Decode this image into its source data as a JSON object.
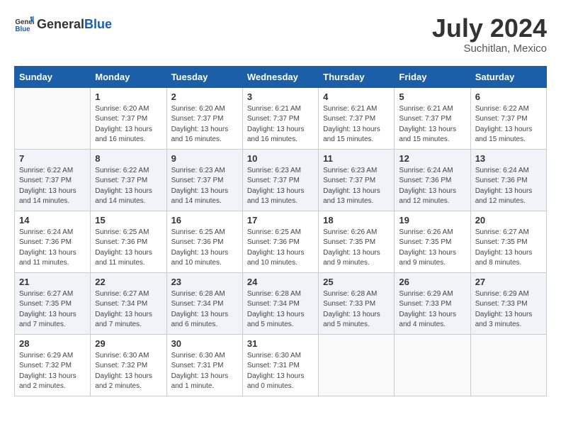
{
  "header": {
    "logo_general": "General",
    "logo_blue": "Blue",
    "month_year": "July 2024",
    "location": "Suchitlan, Mexico"
  },
  "days_of_week": [
    "Sunday",
    "Monday",
    "Tuesday",
    "Wednesday",
    "Thursday",
    "Friday",
    "Saturday"
  ],
  "weeks": [
    [
      {
        "num": "",
        "info": ""
      },
      {
        "num": "1",
        "info": "Sunrise: 6:20 AM\nSunset: 7:37 PM\nDaylight: 13 hours\nand 16 minutes."
      },
      {
        "num": "2",
        "info": "Sunrise: 6:20 AM\nSunset: 7:37 PM\nDaylight: 13 hours\nand 16 minutes."
      },
      {
        "num": "3",
        "info": "Sunrise: 6:21 AM\nSunset: 7:37 PM\nDaylight: 13 hours\nand 16 minutes."
      },
      {
        "num": "4",
        "info": "Sunrise: 6:21 AM\nSunset: 7:37 PM\nDaylight: 13 hours\nand 15 minutes."
      },
      {
        "num": "5",
        "info": "Sunrise: 6:21 AM\nSunset: 7:37 PM\nDaylight: 13 hours\nand 15 minutes."
      },
      {
        "num": "6",
        "info": "Sunrise: 6:22 AM\nSunset: 7:37 PM\nDaylight: 13 hours\nand 15 minutes."
      }
    ],
    [
      {
        "num": "7",
        "info": "Sunrise: 6:22 AM\nSunset: 7:37 PM\nDaylight: 13 hours\nand 14 minutes."
      },
      {
        "num": "8",
        "info": "Sunrise: 6:22 AM\nSunset: 7:37 PM\nDaylight: 13 hours\nand 14 minutes."
      },
      {
        "num": "9",
        "info": "Sunrise: 6:23 AM\nSunset: 7:37 PM\nDaylight: 13 hours\nand 14 minutes."
      },
      {
        "num": "10",
        "info": "Sunrise: 6:23 AM\nSunset: 7:37 PM\nDaylight: 13 hours\nand 13 minutes."
      },
      {
        "num": "11",
        "info": "Sunrise: 6:23 AM\nSunset: 7:37 PM\nDaylight: 13 hours\nand 13 minutes."
      },
      {
        "num": "12",
        "info": "Sunrise: 6:24 AM\nSunset: 7:36 PM\nDaylight: 13 hours\nand 12 minutes."
      },
      {
        "num": "13",
        "info": "Sunrise: 6:24 AM\nSunset: 7:36 PM\nDaylight: 13 hours\nand 12 minutes."
      }
    ],
    [
      {
        "num": "14",
        "info": "Sunrise: 6:24 AM\nSunset: 7:36 PM\nDaylight: 13 hours\nand 11 minutes."
      },
      {
        "num": "15",
        "info": "Sunrise: 6:25 AM\nSunset: 7:36 PM\nDaylight: 13 hours\nand 11 minutes."
      },
      {
        "num": "16",
        "info": "Sunrise: 6:25 AM\nSunset: 7:36 PM\nDaylight: 13 hours\nand 10 minutes."
      },
      {
        "num": "17",
        "info": "Sunrise: 6:25 AM\nSunset: 7:36 PM\nDaylight: 13 hours\nand 10 minutes."
      },
      {
        "num": "18",
        "info": "Sunrise: 6:26 AM\nSunset: 7:35 PM\nDaylight: 13 hours\nand 9 minutes."
      },
      {
        "num": "19",
        "info": "Sunrise: 6:26 AM\nSunset: 7:35 PM\nDaylight: 13 hours\nand 9 minutes."
      },
      {
        "num": "20",
        "info": "Sunrise: 6:27 AM\nSunset: 7:35 PM\nDaylight: 13 hours\nand 8 minutes."
      }
    ],
    [
      {
        "num": "21",
        "info": "Sunrise: 6:27 AM\nSunset: 7:35 PM\nDaylight: 13 hours\nand 7 minutes."
      },
      {
        "num": "22",
        "info": "Sunrise: 6:27 AM\nSunset: 7:34 PM\nDaylight: 13 hours\nand 7 minutes."
      },
      {
        "num": "23",
        "info": "Sunrise: 6:28 AM\nSunset: 7:34 PM\nDaylight: 13 hours\nand 6 minutes."
      },
      {
        "num": "24",
        "info": "Sunrise: 6:28 AM\nSunset: 7:34 PM\nDaylight: 13 hours\nand 5 minutes."
      },
      {
        "num": "25",
        "info": "Sunrise: 6:28 AM\nSunset: 7:33 PM\nDaylight: 13 hours\nand 5 minutes."
      },
      {
        "num": "26",
        "info": "Sunrise: 6:29 AM\nSunset: 7:33 PM\nDaylight: 13 hours\nand 4 minutes."
      },
      {
        "num": "27",
        "info": "Sunrise: 6:29 AM\nSunset: 7:33 PM\nDaylight: 13 hours\nand 3 minutes."
      }
    ],
    [
      {
        "num": "28",
        "info": "Sunrise: 6:29 AM\nSunset: 7:32 PM\nDaylight: 13 hours\nand 2 minutes."
      },
      {
        "num": "29",
        "info": "Sunrise: 6:30 AM\nSunset: 7:32 PM\nDaylight: 13 hours\nand 2 minutes."
      },
      {
        "num": "30",
        "info": "Sunrise: 6:30 AM\nSunset: 7:31 PM\nDaylight: 13 hours\nand 1 minute."
      },
      {
        "num": "31",
        "info": "Sunrise: 6:30 AM\nSunset: 7:31 PM\nDaylight: 13 hours\nand 0 minutes."
      },
      {
        "num": "",
        "info": ""
      },
      {
        "num": "",
        "info": ""
      },
      {
        "num": "",
        "info": ""
      }
    ]
  ]
}
